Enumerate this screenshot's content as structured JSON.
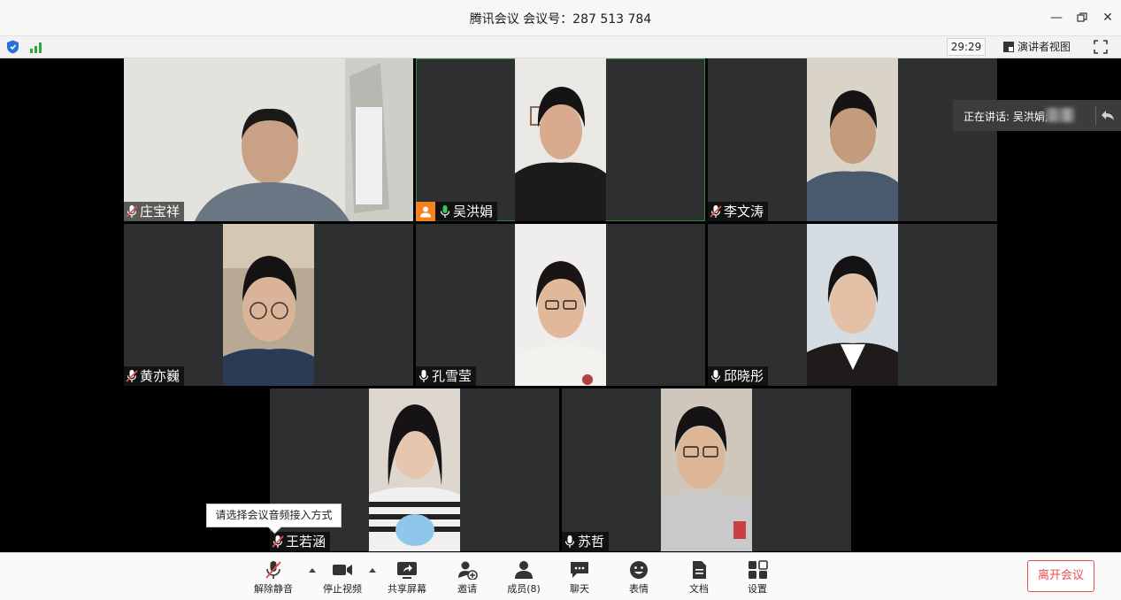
{
  "window": {
    "title": "腾讯会议 会议号：287 513 784",
    "minimize_icon": "minimize-icon",
    "restore_icon": "restore-icon",
    "close_icon": "close-icon"
  },
  "status": {
    "timer": "29:29",
    "view_mode_label": "演讲者视图"
  },
  "speaking": {
    "label": "正在讲话: 吴洪娟;"
  },
  "participants": [
    {
      "name": "庄宝祥",
      "mic": "muted"
    },
    {
      "name": "吴洪娟",
      "mic": "speaking",
      "host": true
    },
    {
      "name": "李文涛",
      "mic": "muted"
    },
    {
      "name": "黄亦巍",
      "mic": "muted"
    },
    {
      "name": "孔雪莹",
      "mic": "on"
    },
    {
      "name": "邱晓彤",
      "mic": "on"
    },
    {
      "name": "王若涵",
      "mic": "muted"
    },
    {
      "name": "苏哲",
      "mic": "on"
    }
  ],
  "tooltip": "请选择会议音频接入方式",
  "toolbar": {
    "unmute": "解除静音",
    "stop_video": "停止视频",
    "share_screen": "共享屏幕",
    "invite": "邀请",
    "members": "成员(8)",
    "chat": "聊天",
    "emoji": "表情",
    "docs": "文档",
    "settings": "设置",
    "leave": "离开会议"
  },
  "colors": {
    "tile_bg": "#2d2f31",
    "host_badge": "#f58220",
    "leave_red": "#e94e4e",
    "active_border": "#2d8a3e"
  }
}
